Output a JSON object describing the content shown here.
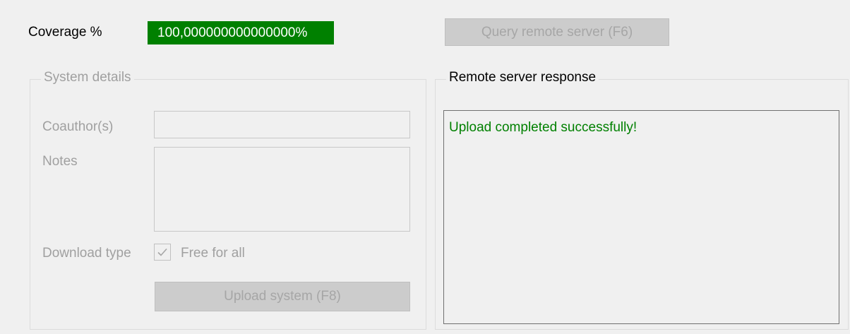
{
  "coverage": {
    "label": "Coverage %",
    "value": "100,000000000000000%",
    "value_bg_color": "#008000"
  },
  "query_button": {
    "label": "Query remote server (F6)",
    "enabled": false
  },
  "system_details": {
    "title": "System details",
    "coauthor": {
      "label": "Coauthor(s)",
      "value": "",
      "enabled": false
    },
    "notes": {
      "label": "Notes",
      "value": "",
      "enabled": false
    },
    "download_type": {
      "label": "Download type",
      "option_label": "Free for all",
      "checked": true,
      "enabled": false
    },
    "upload_button": {
      "label": "Upload system (F8)",
      "enabled": false
    }
  },
  "remote_response": {
    "title": "Remote server response",
    "message": "Upload completed successfully!",
    "message_color": "#008000"
  }
}
